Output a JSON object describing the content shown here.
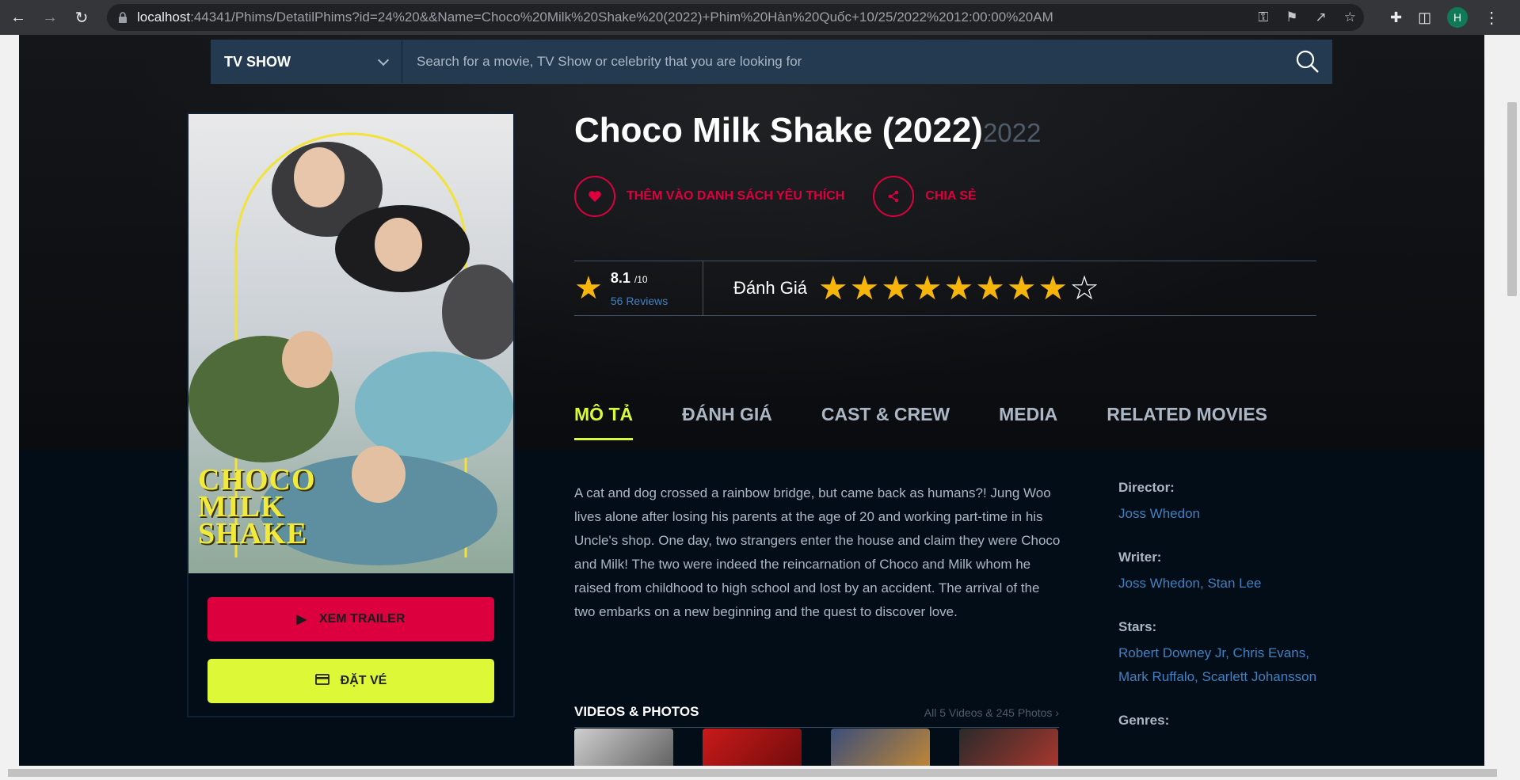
{
  "browser": {
    "url_host": "localhost",
    "url_rest": ":44341/Phims/DetatilPhims?id=24%20&&Name=Choco%20Milk%20Shake%20(2022)+Phim%20Hàn%20Quốc+10/25/2022%2012:00:00%20AM",
    "profile_initial": "H"
  },
  "search": {
    "type_value": "TV SHOW",
    "placeholder": "Search for a movie, TV Show or celebrity that you are looking for"
  },
  "poster": {
    "title_art": "CHOCO MILK SHAKE"
  },
  "movie": {
    "title": "Choco Milk Shake (2022)",
    "year": "2022"
  },
  "actions": {
    "favorite_label": "THÊM VÀO DANH SÁCH YÊU THÍCH",
    "share_label": "CHIA SẺ"
  },
  "buttons": {
    "trailer_label": "XEM TRAILER",
    "ticket_label": "ĐẶT VÉ"
  },
  "rating": {
    "score": "8.1",
    "out_of": "/10",
    "reviews": "56 Reviews",
    "rate_label": "Đánh Giá",
    "stars_filled": 8,
    "stars_total": 9
  },
  "tabs": [
    {
      "label": "MÔ TẢ",
      "active": true
    },
    {
      "label": "ĐÁNH GIÁ",
      "active": false
    },
    {
      "label": "CAST & CREW",
      "active": false
    },
    {
      "label": "MEDIA",
      "active": false
    },
    {
      "label": "RELATED MOVIES",
      "active": false
    }
  ],
  "overview": {
    "description": "A cat and dog crossed a rainbow bridge, but came back as humans?! Jung Woo lives alone after losing his parents at the age of 20 and working part-time in his Uncle's shop. One day, two strangers enter the house and claim they were Choco and Milk! The two were indeed the reincarnation of Choco and Milk whom he raised from childhood to high school and lost by an accident. The arrival of the two embarks on a new beginning and the quest to discover love.",
    "videos_title": "VIDEOS & PHOTOS",
    "videos_all": "All 5 Videos & 245 Photos"
  },
  "side": {
    "director_label": "Director:",
    "director": "Joss Whedon",
    "writer_label": "Writer:",
    "writer": "Joss Whedon, Stan Lee",
    "stars_label": "Stars:",
    "stars": "Robert Downey Jr, Chris Evans, Mark Ruffalo, Scarlett Johansson",
    "genres_label": "Genres:"
  },
  "colors": {
    "accent_red": "#dd003f",
    "accent_yellow": "#dcf836",
    "star": "#f5b50a",
    "link": "#4280bf"
  }
}
